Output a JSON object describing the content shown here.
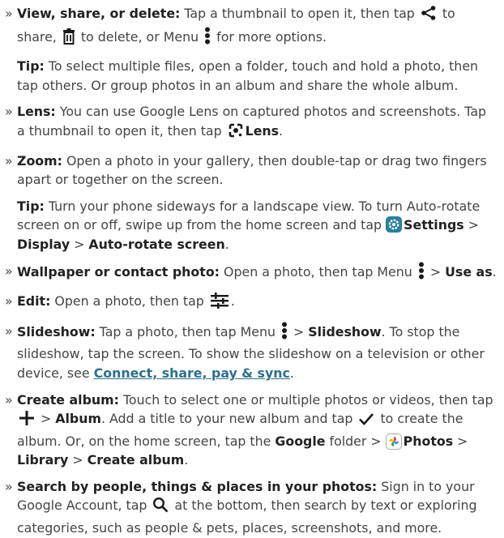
{
  "items": {
    "view": {
      "title": "View, share, or delete:",
      "t1": " Tap a thumbnail to open it, then tap ",
      "t2": " to share, ",
      "t3": " to delete, or Menu ",
      "t4": " for more options."
    },
    "tip1": {
      "label": "Tip:",
      "text": " To select multiple files, open a folder, touch and hold a photo, then tap others. Or group photos in an album and share the whole album."
    },
    "lens": {
      "title": "Lens:",
      "t1": " You can use Google Lens on captured photos and screenshots. Tap a thumbnail to open it, then tap ",
      "bold": "Lens",
      "t2": "."
    },
    "zoom": {
      "title": "Zoom:",
      "t1": " Open a photo in your gallery, then double-tap or drag two fingers apart or together on the screen."
    },
    "tip2": {
      "label": "Tip:",
      "t1": " Turn your phone sideways for a landscape view. To turn Auto-rotate screen on or off, swipe up from the home screen and tap ",
      "settings": "Settings",
      "sep1": " > ",
      "display": "Display",
      "sep2": " > ",
      "autorotate": "Auto-rotate screen",
      "end": "."
    },
    "wallpaper": {
      "title": "Wallpaper or contact photo:",
      "t1": " Open a photo, then tap Menu ",
      "sep": " > ",
      "useas": "Use as",
      "end": "."
    },
    "edit": {
      "title": "Edit:",
      "t1": " Open a photo, then tap ",
      "end": "."
    },
    "slideshow": {
      "title": "Slideshow:",
      "t1": " Tap a photo, then tap Menu ",
      "sep": " > ",
      "bold": "Slideshow",
      "t2": ". To stop the slideshow, tap the screen. To show the slideshow on a television or other device, see ",
      "link": "Connect, share, pay & sync",
      "end": "."
    },
    "album": {
      "title": "Create album:",
      "t1": " Touch to select one or multiple photos or videos, then tap ",
      "sep1": " > ",
      "album": "Album",
      "t2": ". Add a title to your new album and tap ",
      "t3": " to create the album. Or, on the home screen, tap the ",
      "google": "Google",
      "t4": " folder > ",
      "photos": "Photos",
      "sep2": " > ",
      "library": "Library",
      "sep3": " > ",
      "create": "Create album",
      "end": "."
    },
    "search": {
      "title": "Search by people, things & places in your photos:",
      "t1": " Sign in to your Google Account, tap ",
      "t2": " at the bottom, then search by text or exploring categories, such as people & pets, places, screenshots, and more."
    }
  },
  "icons": {
    "share": "share-icon",
    "delete": "trash-icon",
    "menu": "more-vert-icon",
    "lens": "google-lens-icon",
    "settings": "settings-gear-icon",
    "edit": "tune-sliders-icon",
    "add": "plus-icon",
    "check": "checkmark-icon",
    "photos": "google-photos-icon",
    "search": "search-icon"
  },
  "colors": {
    "link": "#2f6f8f",
    "settings_badge": "#2a7f9e"
  }
}
